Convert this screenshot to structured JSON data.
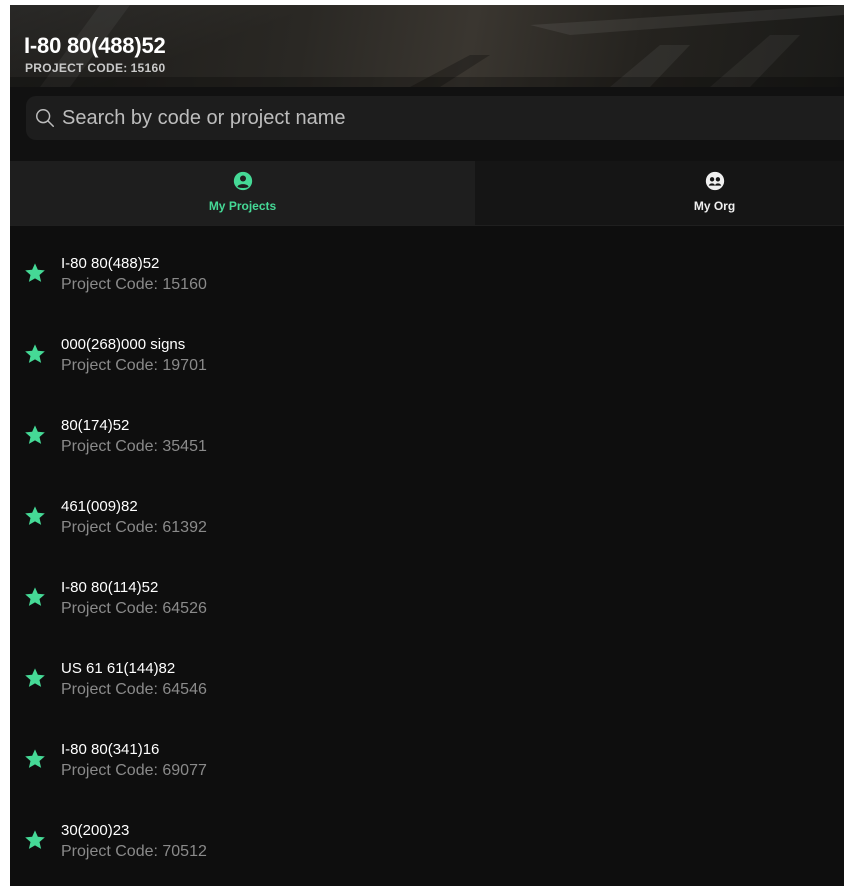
{
  "header": {
    "title": "I-80 80(488)52",
    "code_label": "PROJECT CODE:",
    "code_value": "15160"
  },
  "search": {
    "placeholder": "Search by code or project name",
    "value": ""
  },
  "tabs": [
    {
      "label": "My Projects",
      "icon": "user-circle-icon",
      "active": true
    },
    {
      "label": "My Org",
      "icon": "group-icon",
      "active": false
    }
  ],
  "projects": [
    {
      "name": "I-80 80(488)52",
      "code_label": "Project Code: 15160",
      "favorite": true
    },
    {
      "name": "000(268)000 signs",
      "code_label": "Project Code: 19701",
      "favorite": true
    },
    {
      "name": "80(174)52",
      "code_label": "Project Code: 35451",
      "favorite": true
    },
    {
      "name": "461(009)82",
      "code_label": "Project Code: 61392",
      "favorite": true
    },
    {
      "name": "I-80 80(114)52",
      "code_label": "Project Code: 64526",
      "favorite": true
    },
    {
      "name": "US 61 61(144)82",
      "code_label": "Project Code: 64546",
      "favorite": true
    },
    {
      "name": "I-80 80(341)16",
      "code_label": "Project Code: 69077",
      "favorite": true
    },
    {
      "name": "30(200)23",
      "code_label": "Project Code: 70512",
      "favorite": true
    }
  ],
  "colors": {
    "accent": "#45d996",
    "background": "#0e0e0e"
  }
}
